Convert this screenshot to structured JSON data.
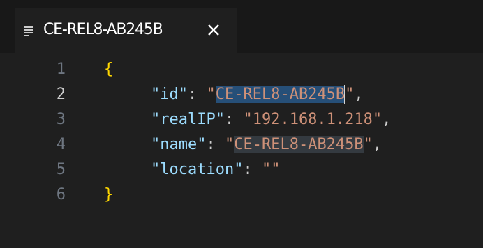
{
  "tab": {
    "title": "CE-REL8-AB245B",
    "icon": "text-lines-icon",
    "close_glyph": "✕"
  },
  "editor": {
    "line_numbers": [
      "1",
      "2",
      "3",
      "4",
      "5",
      "6"
    ],
    "active_line": "2",
    "lines": {
      "l1": "{",
      "l2_key": "\"id\"",
      "l2_colon": ": ",
      "l2_q1": "\"",
      "l2_value": "CE-REL8-AB245B",
      "l2_q2": "\"",
      "l2_comma": ",",
      "l3_key": "\"realIP\"",
      "l3_colon": ": ",
      "l3_value": "\"192.168.1.218\"",
      "l3_comma": ",",
      "l4_key": "\"name\"",
      "l4_colon": ": ",
      "l4_q1": "\"",
      "l4_value": "CE-REL8-AB245B",
      "l4_q2": "\"",
      "l4_comma": ",",
      "l5_key": "\"location\"",
      "l5_colon": ": ",
      "l5_value": "\"\"",
      "l6": "}"
    }
  },
  "colors": {
    "background": "#1f1f1f",
    "tabbar": "#181818",
    "string": "#ce9178",
    "key": "#9cdcfe",
    "brace": "#ffd700",
    "selection": "#264f78",
    "highlight": "#343a40"
  }
}
